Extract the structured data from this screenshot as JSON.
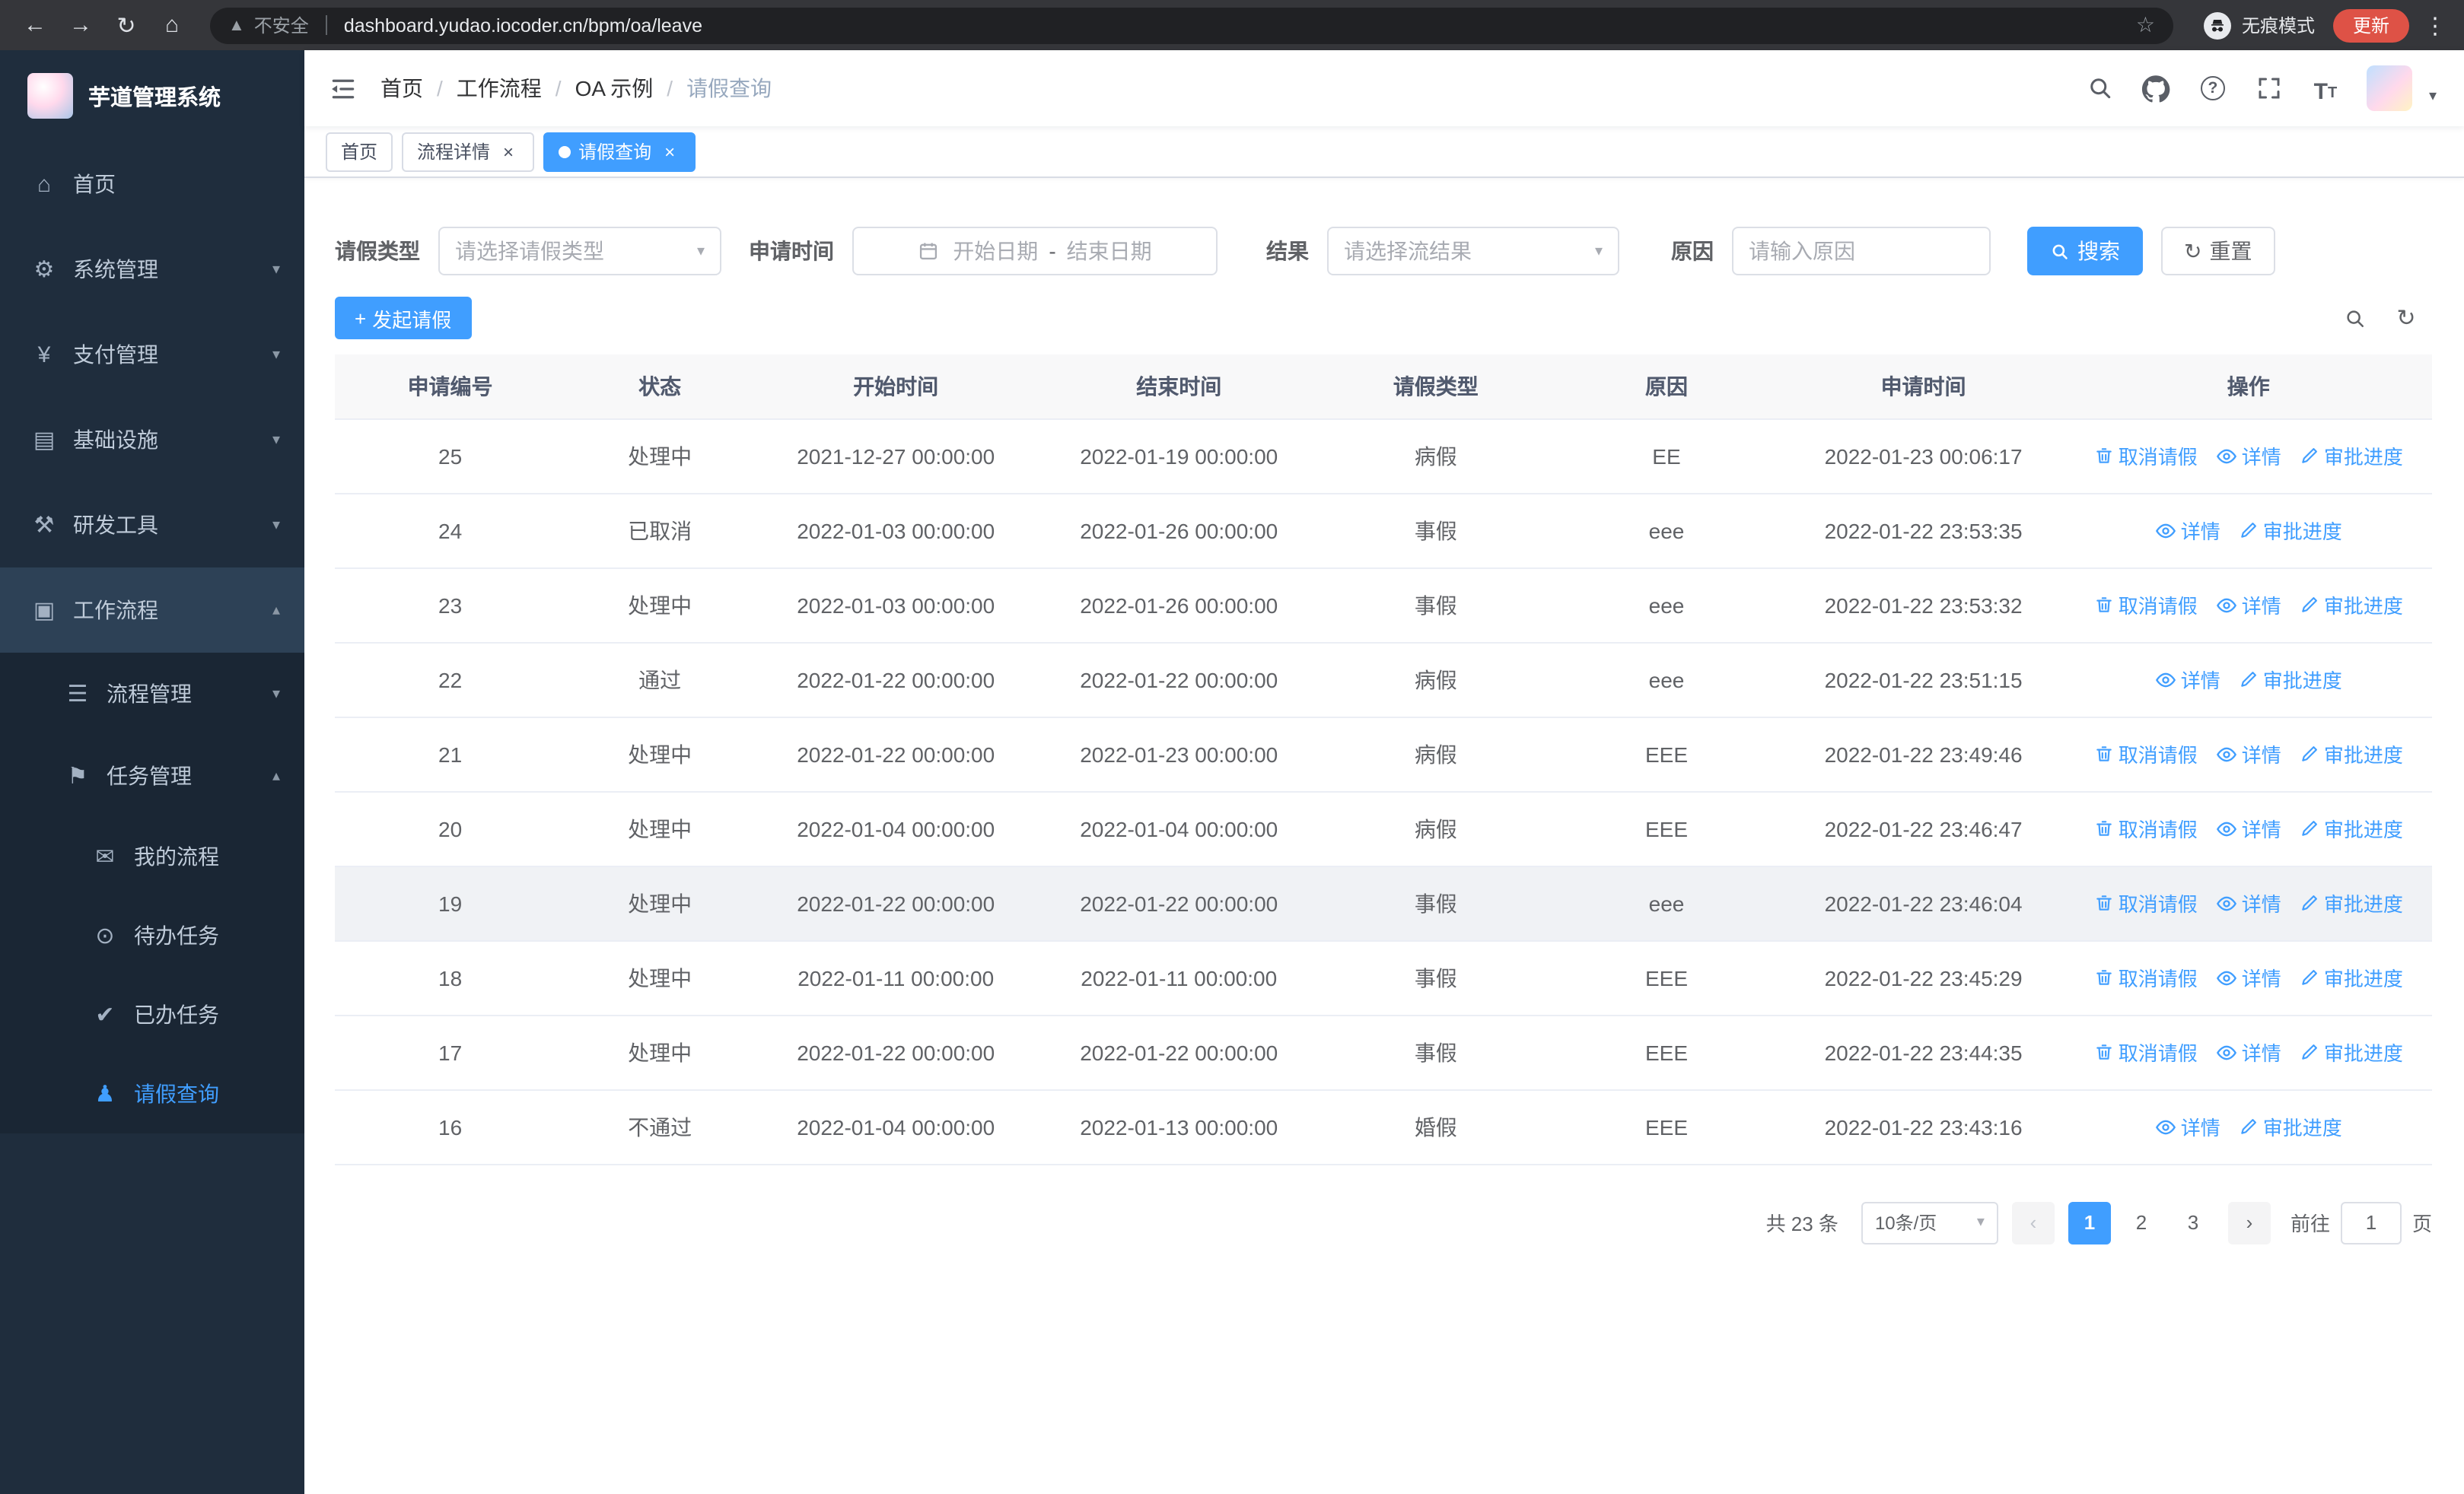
{
  "theme": {
    "accent": "#409eff",
    "sidebar_bg": "#1f2d3d",
    "submenu_bg": "#1a2634"
  },
  "browser": {
    "security_label": "不安全",
    "url": "dashboard.yudao.iocoder.cn/bpm/oa/leave",
    "incognito_label": "无痕模式",
    "update_label": "更新"
  },
  "sidebar": {
    "logo_title": "芋道管理系统",
    "items": [
      {
        "key": "home",
        "label": "首页",
        "icon": "dashboard-icon",
        "level": 1
      },
      {
        "key": "system-management",
        "label": "系统管理",
        "icon": "gear-icon",
        "level": 1,
        "chevron": "down"
      },
      {
        "key": "payment-management",
        "label": "支付管理",
        "icon": "yen-icon",
        "level": 1,
        "chevron": "down"
      },
      {
        "key": "infrastructure",
        "label": "基础设施",
        "icon": "infrastructure-icon",
        "level": 1,
        "chevron": "down"
      },
      {
        "key": "dev-tools",
        "label": "研发工具",
        "icon": "tools-icon",
        "level": 1,
        "chevron": "down"
      },
      {
        "key": "workflow",
        "label": "工作流程",
        "icon": "workflow-icon",
        "level": 1,
        "chevron": "up",
        "open": true
      },
      {
        "key": "process-management",
        "label": "流程管理",
        "icon": "process-management-icon",
        "level": 2,
        "chevron": "down"
      },
      {
        "key": "task-management",
        "label": "任务管理",
        "icon": "task-management-icon",
        "level": 2,
        "chevron": "up"
      },
      {
        "key": "my-process",
        "label": "我的流程",
        "icon": "my-process-icon",
        "level": 3
      },
      {
        "key": "todo-tasks",
        "label": "待办任务",
        "icon": "todo-tasks-icon",
        "level": 3
      },
      {
        "key": "done-tasks",
        "label": "已办任务",
        "icon": "done-tasks-icon",
        "level": 3
      },
      {
        "key": "leave-query",
        "label": "请假查询",
        "icon": "leave-query-icon",
        "level": 3,
        "active": true
      }
    ]
  },
  "header": {
    "breadcrumb": [
      "首页",
      "工作流程",
      "OA 示例",
      "请假查询"
    ]
  },
  "tabs": [
    {
      "label": "首页",
      "closable": false,
      "active": false
    },
    {
      "label": "流程详情",
      "closable": true,
      "active": false
    },
    {
      "label": "请假查询",
      "closable": true,
      "active": true
    }
  ],
  "filters": {
    "leave_type_label": "请假类型",
    "leave_type_placeholder": "请选择请假类型",
    "apply_time_label": "申请时间",
    "start_date_placeholder": "开始日期",
    "range_separator": "-",
    "end_date_placeholder": "结束日期",
    "result_label": "结果",
    "result_placeholder": "请选择流结果",
    "reason_label": "原因",
    "reason_placeholder": "请输入原因",
    "search_label": "搜索",
    "reset_label": "重置"
  },
  "toolbar": {
    "create_label": "发起请假"
  },
  "table": {
    "columns": [
      "申请编号",
      "状态",
      "开始时间",
      "结束时间",
      "请假类型",
      "原因",
      "申请时间",
      "操作"
    ],
    "op_labels": {
      "cancel": "取消请假",
      "detail": "详情",
      "progress": "审批进度"
    },
    "rows": [
      {
        "id": "25",
        "status": "处理中",
        "start": "2021-12-27 00:00:00",
        "end": "2022-01-19 00:00:00",
        "type": "病假",
        "reason": "EE",
        "applied": "2022-01-23 00:06:17",
        "ops": [
          "cancel",
          "detail",
          "progress"
        ],
        "highlight": false
      },
      {
        "id": "24",
        "status": "已取消",
        "start": "2022-01-03 00:00:00",
        "end": "2022-01-26 00:00:00",
        "type": "事假",
        "reason": "eee",
        "applied": "2022-01-22 23:53:35",
        "ops": [
          "detail",
          "progress"
        ],
        "highlight": false
      },
      {
        "id": "23",
        "status": "处理中",
        "start": "2022-01-03 00:00:00",
        "end": "2022-01-26 00:00:00",
        "type": "事假",
        "reason": "eee",
        "applied": "2022-01-22 23:53:32",
        "ops": [
          "cancel",
          "detail",
          "progress"
        ],
        "highlight": false
      },
      {
        "id": "22",
        "status": "通过",
        "start": "2022-01-22 00:00:00",
        "end": "2022-01-22 00:00:00",
        "type": "病假",
        "reason": "eee",
        "applied": "2022-01-22 23:51:15",
        "ops": [
          "detail",
          "progress"
        ],
        "highlight": false
      },
      {
        "id": "21",
        "status": "处理中",
        "start": "2022-01-22 00:00:00",
        "end": "2022-01-23 00:00:00",
        "type": "病假",
        "reason": "EEE",
        "applied": "2022-01-22 23:49:46",
        "ops": [
          "cancel",
          "detail",
          "progress"
        ],
        "highlight": false
      },
      {
        "id": "20",
        "status": "处理中",
        "start": "2022-01-04 00:00:00",
        "end": "2022-01-04 00:00:00",
        "type": "病假",
        "reason": "EEE",
        "applied": "2022-01-22 23:46:47",
        "ops": [
          "cancel",
          "detail",
          "progress"
        ],
        "highlight": false
      },
      {
        "id": "19",
        "status": "处理中",
        "start": "2022-01-22 00:00:00",
        "end": "2022-01-22 00:00:00",
        "type": "事假",
        "reason": "eee",
        "applied": "2022-01-22 23:46:04",
        "ops": [
          "cancel",
          "detail",
          "progress"
        ],
        "highlight": true
      },
      {
        "id": "18",
        "status": "处理中",
        "start": "2022-01-11 00:00:00",
        "end": "2022-01-11 00:00:00",
        "type": "事假",
        "reason": "EEE",
        "applied": "2022-01-22 23:45:29",
        "ops": [
          "cancel",
          "detail",
          "progress"
        ],
        "highlight": false
      },
      {
        "id": "17",
        "status": "处理中",
        "start": "2022-01-22 00:00:00",
        "end": "2022-01-22 00:00:00",
        "type": "事假",
        "reason": "EEE",
        "applied": "2022-01-22 23:44:35",
        "ops": [
          "cancel",
          "detail",
          "progress"
        ],
        "highlight": false
      },
      {
        "id": "16",
        "status": "不通过",
        "start": "2022-01-04 00:00:00",
        "end": "2022-01-13 00:00:00",
        "type": "婚假",
        "reason": "EEE",
        "applied": "2022-01-22 23:43:16",
        "ops": [
          "detail",
          "progress"
        ],
        "highlight": false
      }
    ]
  },
  "pagination": {
    "total_label": "共 23 条",
    "page_size_label": "10条/页",
    "pages": [
      "1",
      "2",
      "3"
    ],
    "active_page": "1",
    "goto_label": "前往",
    "goto_value": "1",
    "goto_suffix_label": "页"
  }
}
